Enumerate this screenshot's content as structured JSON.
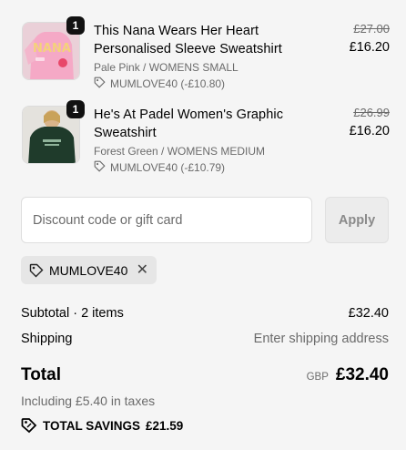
{
  "items": [
    {
      "quantity": "1",
      "title": "This Nana Wears Her Heart Personalised Sleeve Sweatshirt",
      "variant": "Pale Pink / WOMENS SMALL",
      "discount": "MUMLOVE40 (-£10.80)",
      "compare_price": "£27.00",
      "price": "£16.20",
      "image_text": "NANA",
      "image_colors": {
        "bg": "#e9b9c9",
        "garment": "#f3a8c4"
      }
    },
    {
      "quantity": "1",
      "title": "He's At Padel Women's Graphic Sweatshirt",
      "variant": "Forest Green / WOMENS MEDIUM",
      "discount": "MUMLOVE40 (-£10.79)",
      "compare_price": "£26.99",
      "price": "£16.20",
      "image_colors": {
        "bg": "#e3e1dc",
        "garment": "#1f3b2b"
      }
    }
  ],
  "discount_form": {
    "placeholder": "Discount code or gift card",
    "value": "",
    "apply_label": "Apply"
  },
  "applied_code": {
    "code": "MUMLOVE40",
    "icon": "tag-icon",
    "remove_icon": "close-icon"
  },
  "summary": {
    "subtotal_label": "Subtotal · 2 items",
    "subtotal_value": "£32.40",
    "shipping_label": "Shipping",
    "shipping_value": "Enter shipping address",
    "total_label": "Total",
    "currency": "GBP",
    "total_value": "£32.40",
    "taxes": "Including £5.40 in taxes",
    "savings_label": "TOTAL SAVINGS",
    "savings_value": "£21.59"
  },
  "colors": {
    "background": "#f5f5f5",
    "muted_text": "#6b6b6b",
    "badge": "#111111"
  }
}
